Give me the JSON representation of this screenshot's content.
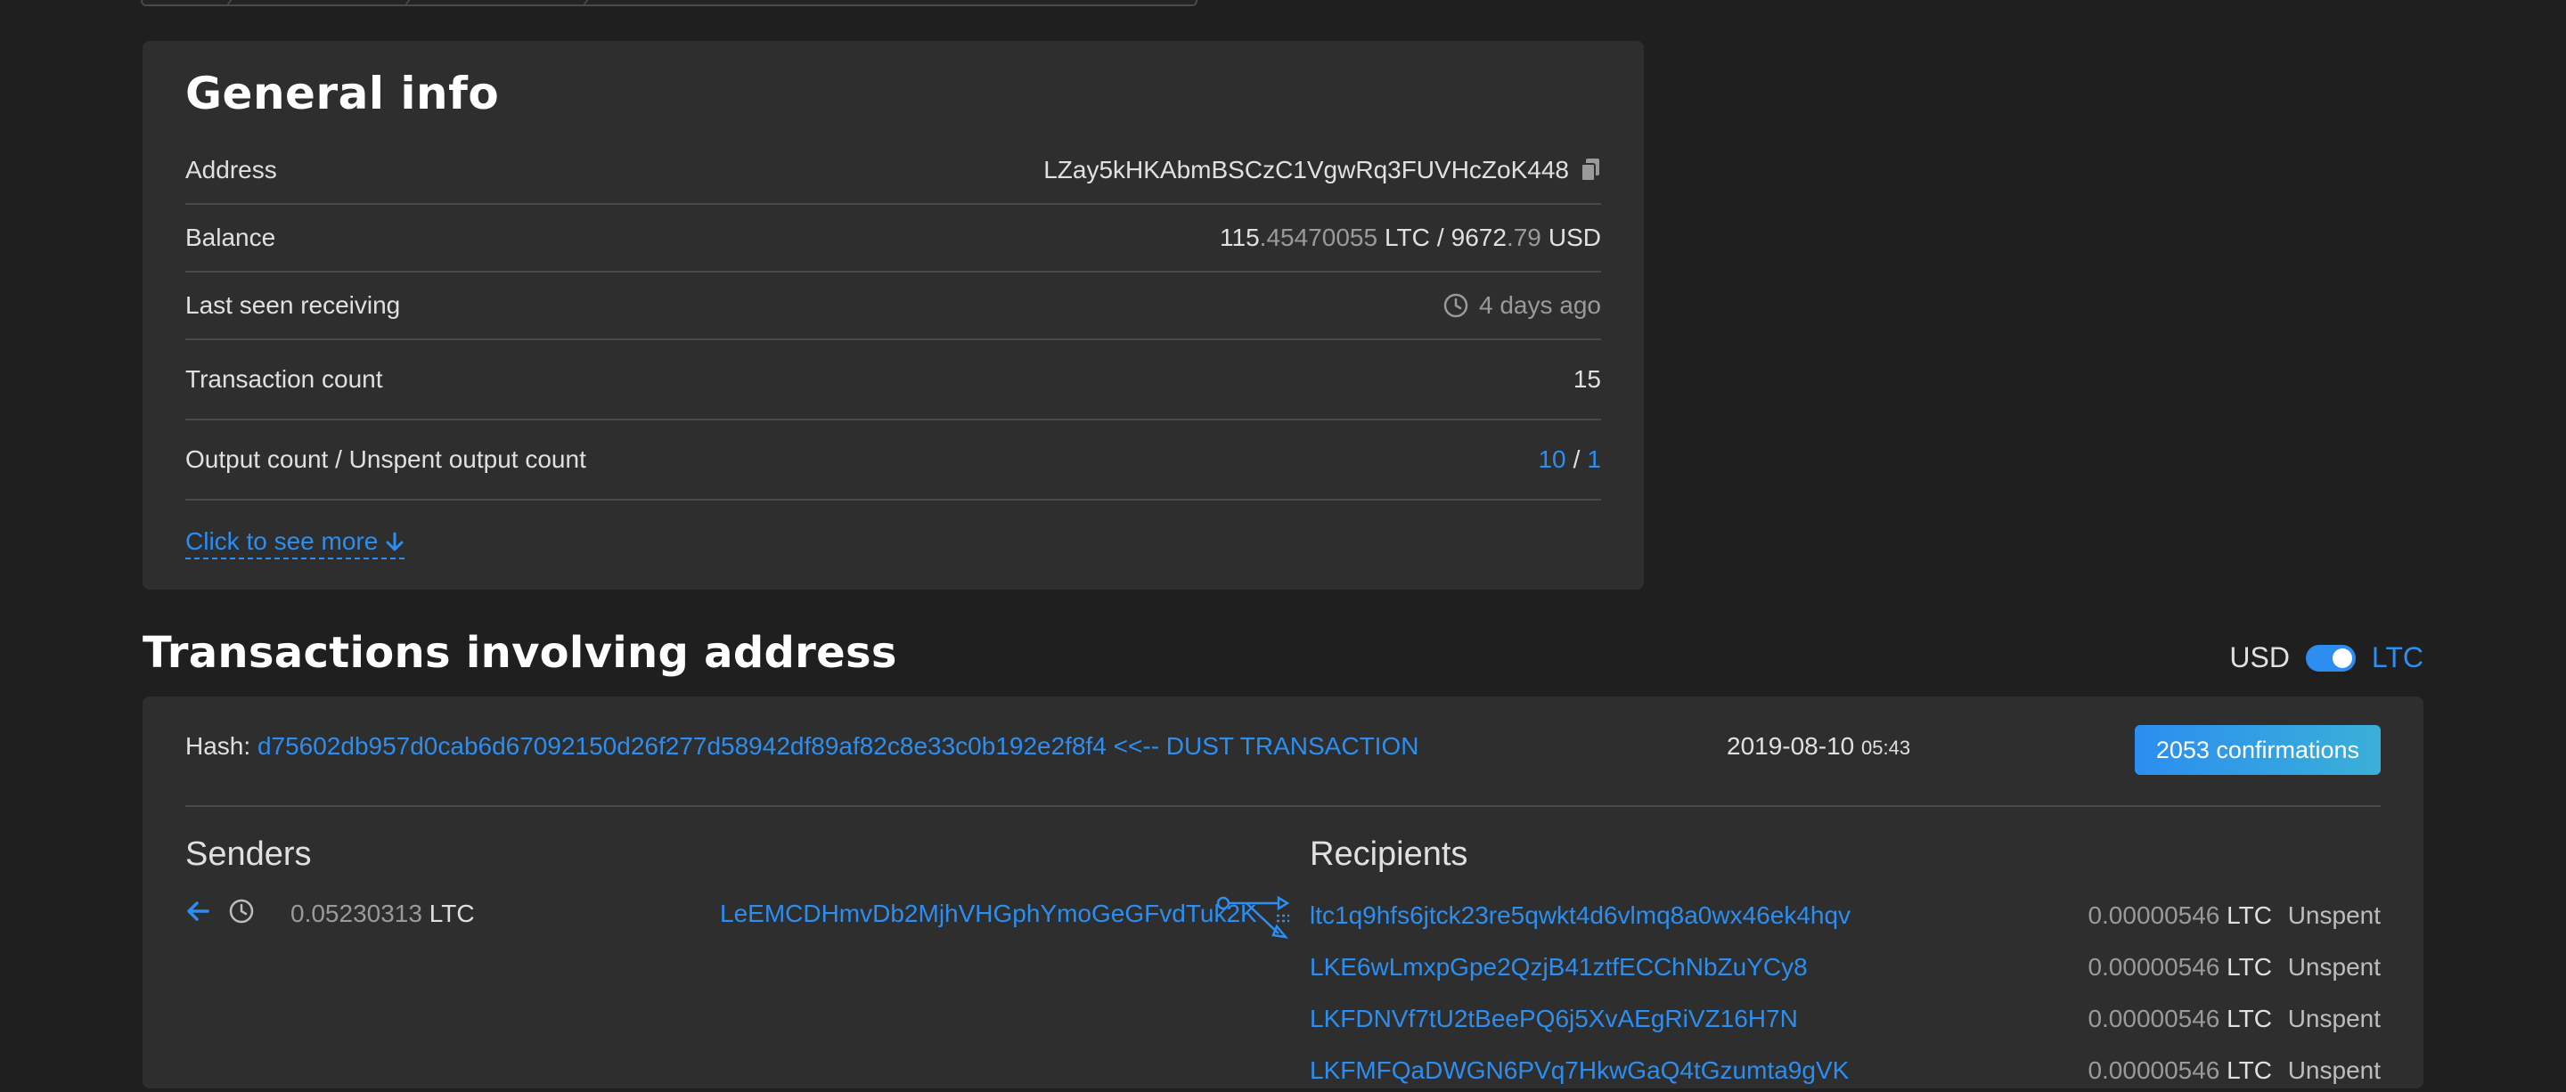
{
  "general": {
    "title": "General info",
    "rows": [
      {
        "label": "Address",
        "value": "LZay5kHKAbmBSCzC1VgwRq3FUVHcZoK448"
      },
      {
        "label": "Balance",
        "int": "115",
        "dec": ".45470055",
        "unit": "LTC",
        "sep": "/",
        "usd_int": "9672",
        "usd_dec": ".79",
        "usd_unit": "USD"
      },
      {
        "label": "Last seen receiving",
        "value": "4 days ago"
      },
      {
        "label": "Transaction count",
        "value": "15"
      },
      {
        "label": "Output count / Unspent output count",
        "outputs": "10",
        "sep": "/",
        "unspent": "1"
      }
    ],
    "see_more": "Click to see more"
  },
  "transactions": {
    "title": "Transactions involving address",
    "currency_left": "USD",
    "currency_right": "LTC",
    "accent": "#2b8ef0",
    "tx": {
      "hash_label": "Hash:",
      "hash": "d75602db957d0cab6d67092150d26f277d58942df89af82c8e33c0b192e2f8f4 <<-- DUST TRANSACTION",
      "date": "2019-08-10",
      "time": "05:43",
      "confirmations": "2053 confirmations",
      "senders_title": "Senders",
      "recipients_title": "Recipients",
      "sender": {
        "amount": "0.05230313",
        "unit": "LTC",
        "address": "LeEMCDHmvDb2MjhVHGphYmoGeGFvdTuk2K"
      },
      "recipients": [
        {
          "address": "ltc1q9hfs6jtck23re5qwkt4d6vlmq8a0wx46ek4hqv",
          "amount": "0.00000546",
          "unit": "LTC",
          "status": "Unspent"
        },
        {
          "address": "LKE6wLmxpGpe2QzjB41ztfECChNbZuYCy8",
          "amount": "0.00000546",
          "unit": "LTC",
          "status": "Unspent"
        },
        {
          "address": "LKFDNVf7tU2tBeePQ6j5XvAEgRiVZ16H7N",
          "amount": "0.00000546",
          "unit": "LTC",
          "status": "Unspent"
        },
        {
          "address": "LKFMFQaDWGN6PVq7HkwGaQ4tGzumta9gVK",
          "amount": "0.00000546",
          "unit": "LTC",
          "status": "Unspent"
        }
      ]
    }
  }
}
